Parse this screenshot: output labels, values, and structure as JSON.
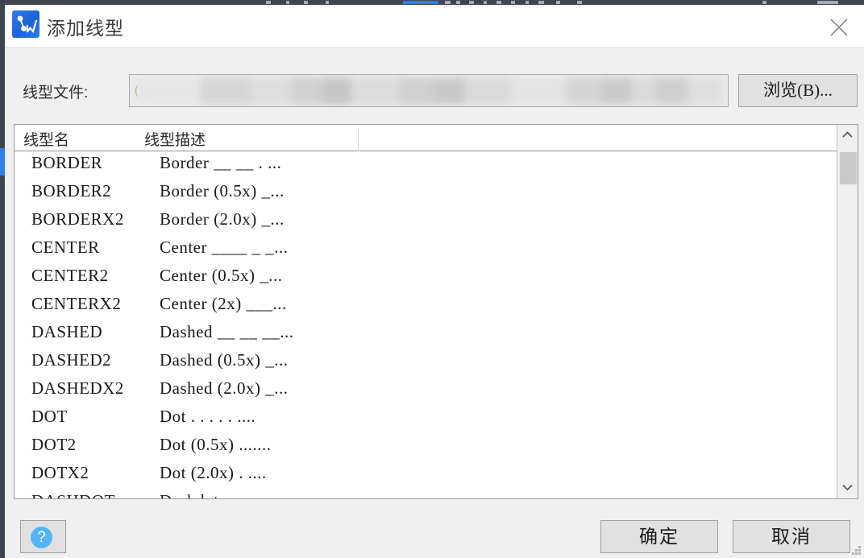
{
  "window": {
    "title": "添加线型",
    "app_icon": "linetype-app-icon",
    "close_icon": "close-icon",
    "titlebar_bg": "#ffffff",
    "dialog_bg": "#f0f0f0",
    "accent_color": "#2f80ea"
  },
  "file_row": {
    "label": "线型文件:",
    "value": "(",
    "value_suffix": "n",
    "redacted": true,
    "browse_label": "浏览(B)..."
  },
  "list": {
    "columns": [
      "线型名",
      "线型描述"
    ],
    "rows": [
      {
        "name": "BORDER",
        "desc": "Border __ __ . ..."
      },
      {
        "name": "BORDER2",
        "desc": "Border (0.5x) _..."
      },
      {
        "name": "BORDERX2",
        "desc": "Border (2.0x) _..."
      },
      {
        "name": "CENTER",
        "desc": "Center ____ _ _..."
      },
      {
        "name": "CENTER2",
        "desc": "Center (0.5x) _..."
      },
      {
        "name": "CENTERX2",
        "desc": "Center (2x) ___..."
      },
      {
        "name": "DASHED",
        "desc": "Dashed __ __ __..."
      },
      {
        "name": "DASHED2",
        "desc": "Dashed (0.5x) _..."
      },
      {
        "name": "DASHEDX2",
        "desc": "Dashed (2.0x) _..."
      },
      {
        "name": "DOT",
        "desc": "Dot . . . . . ...."
      },
      {
        "name": "DOT2",
        "desc": "Dot (0.5x) ......."
      },
      {
        "name": "DOTX2",
        "desc": "Dot (2.0x) .  ...."
      },
      {
        "name": "DASHDOT",
        "desc": "Dashdot ."
      }
    ],
    "scrollbar": {
      "up_icon": "chevron-up-icon",
      "down_icon": "chevron-down-icon",
      "thumb_position_pct": 8
    }
  },
  "footer": {
    "help_label": "?",
    "help_icon": "help-circle-icon",
    "ok_label": "确定",
    "cancel_label": "取消",
    "resize_grip_icon": "resize-grip-icon"
  }
}
